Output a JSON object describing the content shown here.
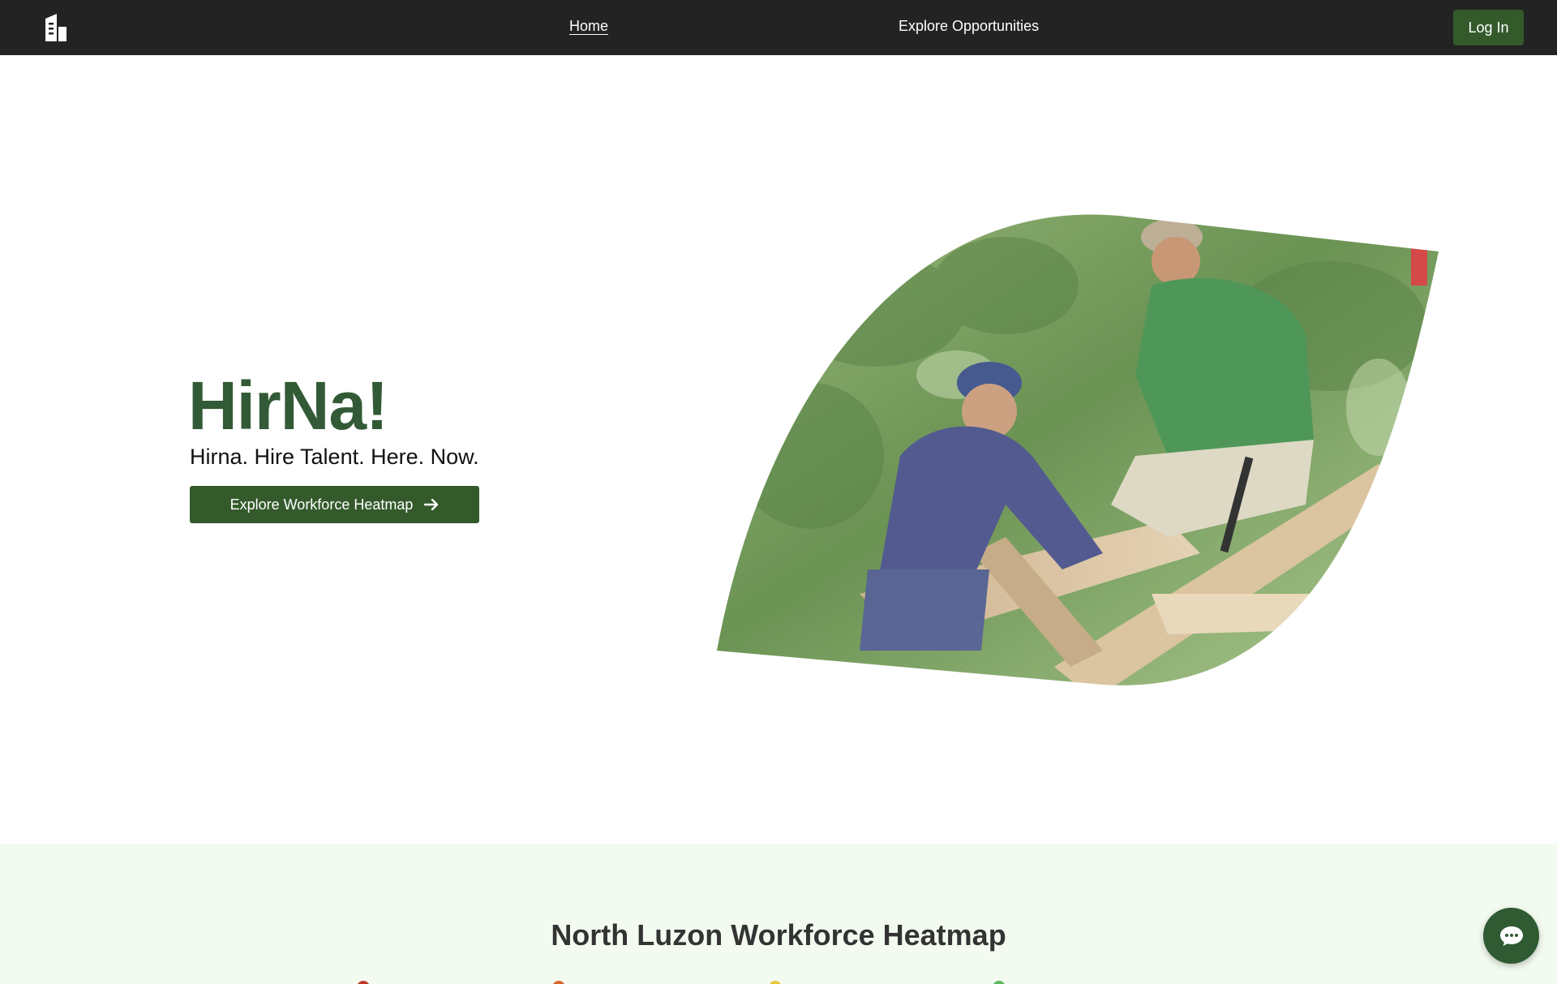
{
  "navbar": {
    "logo_icon": "building-icon",
    "links": [
      {
        "label": "Home",
        "active": true
      },
      {
        "label": "Explore Opportunities",
        "active": false
      }
    ],
    "login_label": "Log In"
  },
  "hero": {
    "title": "HirNa!",
    "subtitle": "Hirna. Hire Talent. Here. Now.",
    "cta_label": "Explore Workforce Heatmap",
    "cta_icon": "arrow-right-icon",
    "image_alt": "Construction workers measuring wooden beams"
  },
  "heatmap": {
    "title": "North Luzon Workforce Heatmap",
    "legend_colors": [
      "#c0392b",
      "#d9662a",
      "#e8c53a",
      "#5cb85c"
    ]
  },
  "chat": {
    "icon": "chat-icon"
  },
  "colors": {
    "brand": "#345a2c",
    "title_green": "#335a36",
    "nav_bg": "#232323",
    "section_bg": "#f3fbf0"
  }
}
